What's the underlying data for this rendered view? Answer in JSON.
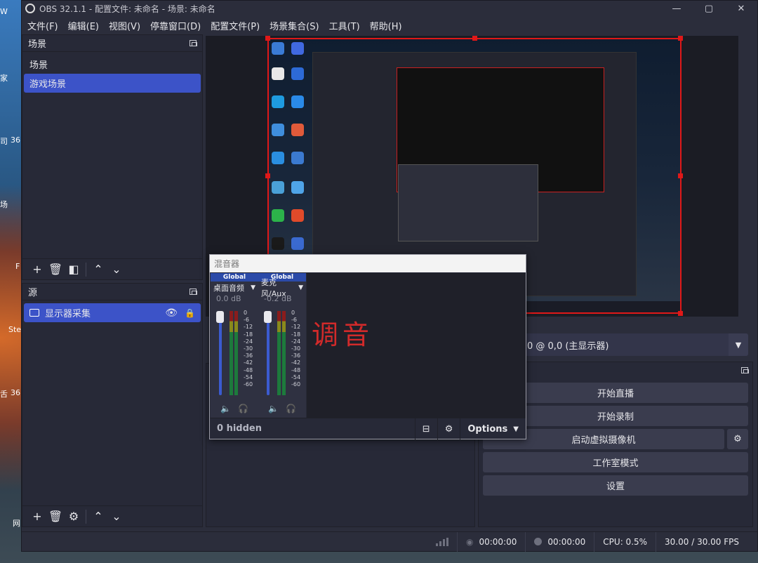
{
  "window": {
    "title": "OBS 32.1.1 - 配置文件: 未命名 - 场景: 未命名",
    "controls": [
      "—",
      "▢",
      "✕"
    ]
  },
  "menu": [
    "文件(F)",
    "编辑(E)",
    "视图(V)",
    "停靠窗口(D)",
    "配置文件(P)",
    "场景集合(S)",
    "工具(T)",
    "帮助(H)"
  ],
  "desktop_labels": [
    "W",
    "家",
    "司",
    "36",
    "场",
    "F",
    "Ste",
    "舌",
    "36",
    "网"
  ],
  "scenes": {
    "title": "场景",
    "items": [
      {
        "label": "场景",
        "selected": false
      },
      {
        "label": "游戏场景",
        "selected": true
      }
    ]
  },
  "sources": {
    "title": "源",
    "items": [
      {
        "label": "显示器采集",
        "selected": true
      }
    ]
  },
  "source_select": {
    "value": "0 @ 0,0 (主显示器)"
  },
  "mixer": {
    "title": "混音器",
    "channels": [
      {
        "group": "Global",
        "name": "桌面音频",
        "db": "0.0 dB",
        "level": 0.0
      },
      {
        "group": "Global",
        "name": "麦克风/Aux",
        "db": "-0.2 dB",
        "level": 0.02
      }
    ],
    "scale": [
      "0",
      "-6",
      "-12",
      "-18",
      "-24",
      "-30",
      "-36",
      "-42",
      "-48",
      "-54",
      "-60"
    ],
    "hidden": "0 hidden",
    "options": "Options",
    "annotation": "调音"
  },
  "controls": {
    "start_stream": "开始直播",
    "start_record": "开始录制",
    "virtual_cam": "启动虚拟摄像机",
    "studio_mode": "工作室模式",
    "settings": "设置"
  },
  "status": {
    "stream_time": "00:00:00",
    "record_time": "00:00:00",
    "cpu": "CPU: 0.5%",
    "fps": "30.00 / 30.00 FPS"
  }
}
